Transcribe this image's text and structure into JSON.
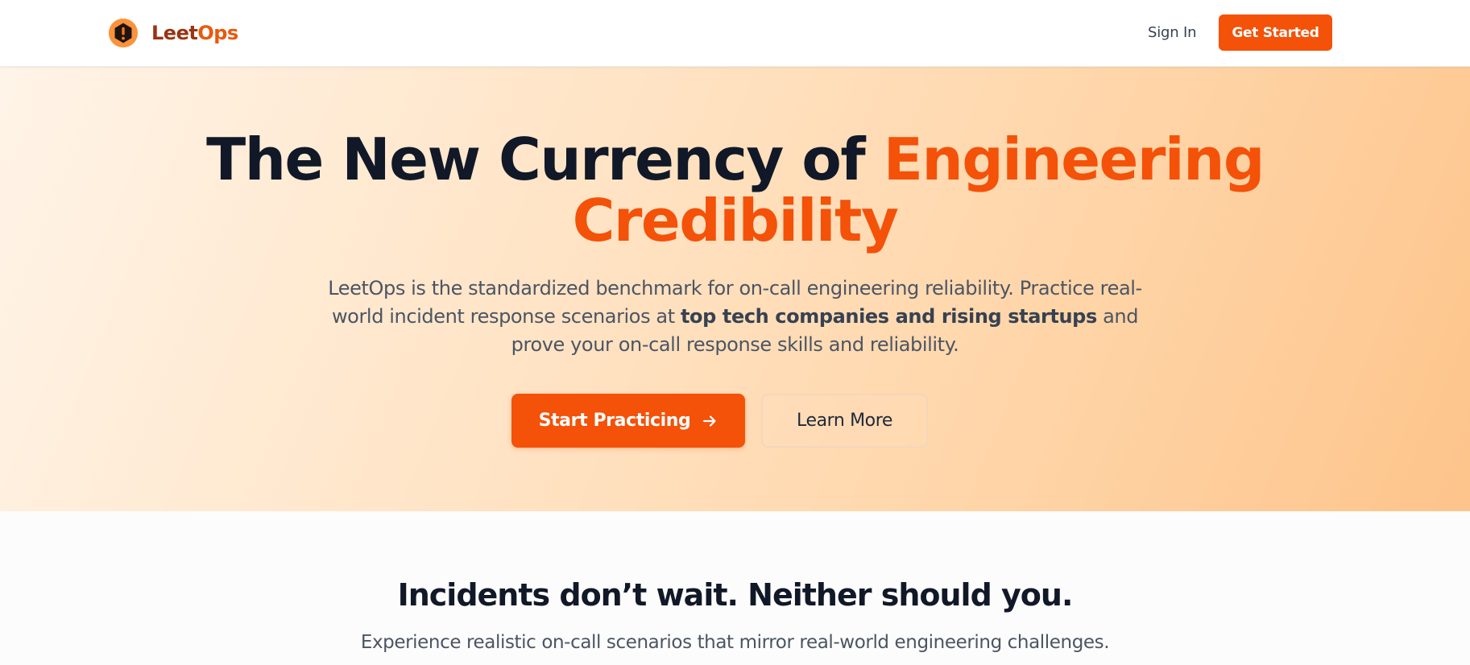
{
  "nav": {
    "brand": "LeetOps",
    "brand_prefix": "Leet",
    "brand_suffix": "Ops",
    "signin": "Sign In",
    "get_started": "Get Started"
  },
  "hero": {
    "title_plain": "The New Currency of ",
    "title_accent_1": "Engineering",
    "title_accent_2": "Credibility",
    "subtitle_part1": "LeetOps is the standardized benchmark for on-call engineering reliability. Practice real-world incident response scenarios at ",
    "subtitle_bold": "top tech companies and rising startups",
    "subtitle_part2": " and prove your on-call response skills and reliability.",
    "cta_primary": "Start Practicing",
    "cta_secondary": "Learn More"
  },
  "section": {
    "title": "Incidents don’t wait. Neither should you.",
    "subtitle": "Experience realistic on-call scenarios that mirror real-world engineering challenges."
  },
  "colors": {
    "accent": "#f45109",
    "text_dark": "#111827",
    "text_muted": "#4b5563",
    "hero_gradient_start": "#fff4e8",
    "hero_gradient_end": "#fdc48b"
  },
  "icons": {
    "logo": "alert-hexagon-icon",
    "cta_arrow": "arrow-right-icon"
  }
}
